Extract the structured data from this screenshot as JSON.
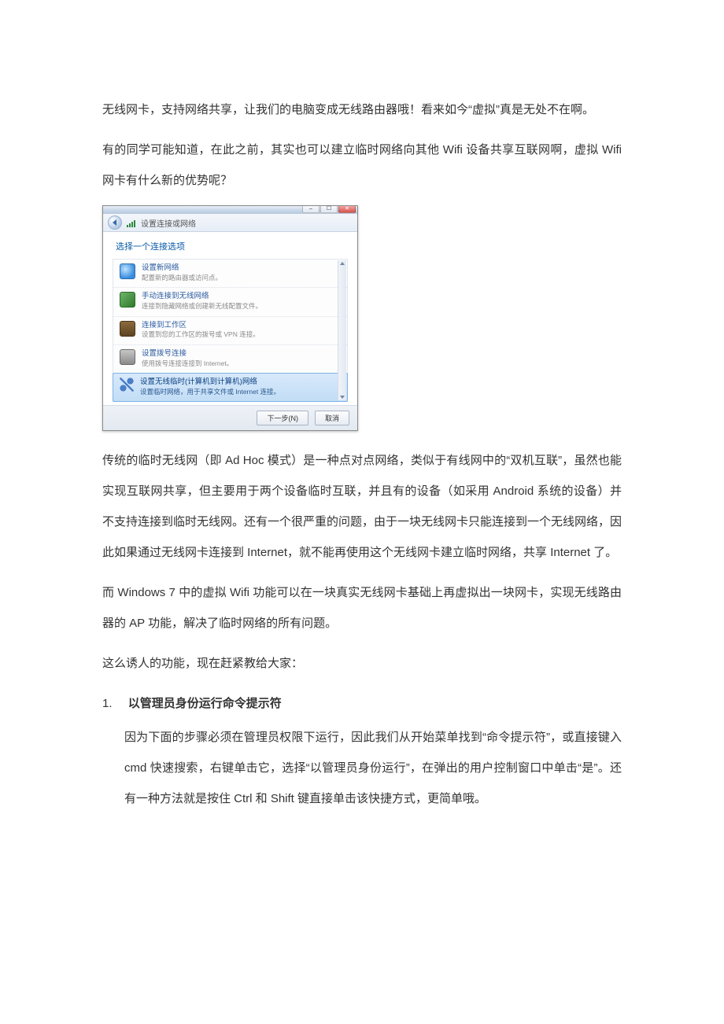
{
  "paragraphs": {
    "p1": "无线网卡，支持网络共享，让我们的电脑变成无线路由器哦！看来如今“虚拟”真是无处不在啊。",
    "p2": "有的同学可能知道，在此之前，其实也可以建立临时网络向其他 Wifi 设备共享互联网啊，虚拟 Wifi 网卡有什么新的优势呢？",
    "p3": "传统的临时无线网（即 Ad Hoc 模式）是一种点对点网络，类似于有线网中的“双机互联”，虽然也能实现互联网共享，但主要用于两个设备临时互联，并且有的设备（如采用 Android 系统的设备）并不支持连接到临时无线网。还有一个很严重的问题，由于一块无线网卡只能连接到一个无线网络，因此如果通过无线网卡连接到 Internet，就不能再使用这个无线网卡建立临时网络，共享 Internet 了。",
    "p4": "而 Windows 7 中的虚拟 Wifi 功能可以在一块真实无线网卡基础上再虚拟出一块网卡，实现无线路由器的 AP 功能，解决了临时网络的所有问题。",
    "p5": "这么诱人的功能，现在赶紧教给大家：",
    "step1_num": "1.",
    "step1_title": "以管理员身份运行命令提示符",
    "step1_body": "因为下面的步骤必须在管理员权限下运行，因此我们从开始菜单找到“命令提示符”，或直接键入 cmd 快速搜索，右键单击它，选择“以管理员身份运行”，在弹出的用户控制窗口中单击“是”。还有一种方法就是按住 Ctrl 和 Shift 键直接单击该快捷方式，更简单哦。"
  },
  "wizard": {
    "crumb": "设置连接或网络",
    "heading": "选择一个连接选项",
    "opts": [
      {
        "title": "设置新网络",
        "sub": "配置新的路由器或访问点。"
      },
      {
        "title": "手动连接到无线网络",
        "sub": "连接到隐藏网络或创建新无线配置文件。"
      },
      {
        "title": "连接到工作区",
        "sub": "设置到您的工作区的拨号或 VPN 连接。"
      },
      {
        "title": "设置拨号连接",
        "sub": "使用拨号连接连接到 Internet。"
      },
      {
        "title": "设置无线临时(计算机到计算机)网络",
        "sub": "设置临时网络，用于共享文件或 Internet 连接。"
      }
    ],
    "next_btn": "下一步(N)",
    "cancel_btn": "取消"
  }
}
